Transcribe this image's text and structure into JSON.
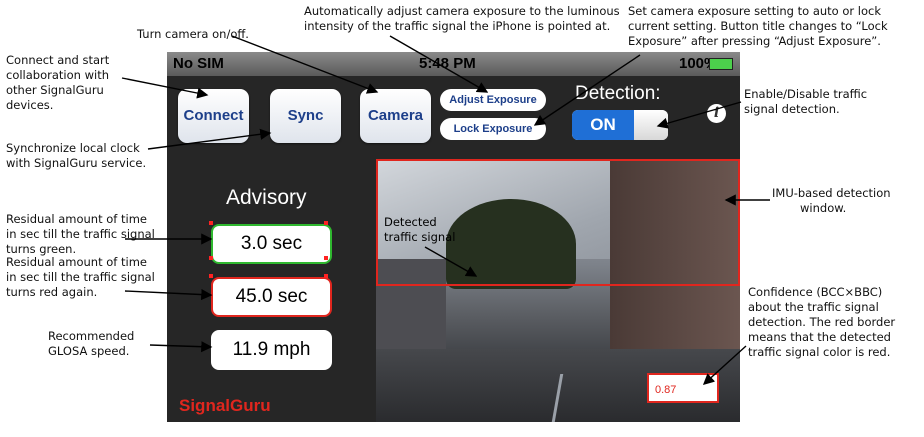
{
  "status_bar": {
    "carrier": "No SIM",
    "time": "5:48 PM",
    "battery": "100%",
    "battery_icon": "battery-charging-icon"
  },
  "toolbar": {
    "connect_label": "Connect",
    "sync_label": "Sync",
    "camera_label": "Camera",
    "adjust_exposure_label": "Adjust Exposure",
    "lock_exposure_label": "Lock Exposure",
    "detection_label": "Detection:",
    "detection_toggle_state": "ON",
    "info_icon": "info-icon"
  },
  "advisory": {
    "title": "Advisory",
    "green_time": "3.0 sec",
    "red_time": "45.0 sec",
    "speed": "11.9 mph",
    "brand": "SignalGuru"
  },
  "camera_view": {
    "detected_label_line1": "Detected",
    "detected_label_line2": "traffic signal",
    "confidence": "0.87"
  },
  "annotations": {
    "turn_camera": "Turn camera on/off.",
    "auto_adjust": [
      "Automatically adjust camera exposure to the luminous",
      "intensity of the traffic signal the iPhone is pointed at."
    ],
    "set_exposure": [
      "Set camera exposure setting to auto or lock",
      "current setting. Button title changes to “Lock",
      "Exposure” after pressing “Adjust Exposure”."
    ],
    "connect": [
      "Connect and start",
      "collaboration with",
      "other SignalGuru",
      "devices."
    ],
    "sync": [
      "Synchronize local clock",
      "with SignalGuru service."
    ],
    "enable_detection": [
      "Enable/Disable traffic",
      "signal detection."
    ],
    "imu": [
      "IMU-based detection",
      "window."
    ],
    "residual_green": [
      "Residual amount of time",
      "in sec till the traffic signal",
      "turns green."
    ],
    "residual_red": [
      "Residual amount of time",
      "in sec till the traffic signal",
      "turns red again."
    ],
    "glosa": [
      "Recommended",
      "GLOSA speed."
    ],
    "confidence": [
      "Confidence (BCC×BBC)",
      "about the traffic signal",
      "detection. The red border",
      "means that the detected",
      "traffic signal color is red."
    ]
  },
  "colors": {
    "detection_window": "#e0261e",
    "green_border": "#2fb82f",
    "red_border": "#e0261e",
    "brand": "#e0261e",
    "toggle_on": "#1f6fd6"
  }
}
